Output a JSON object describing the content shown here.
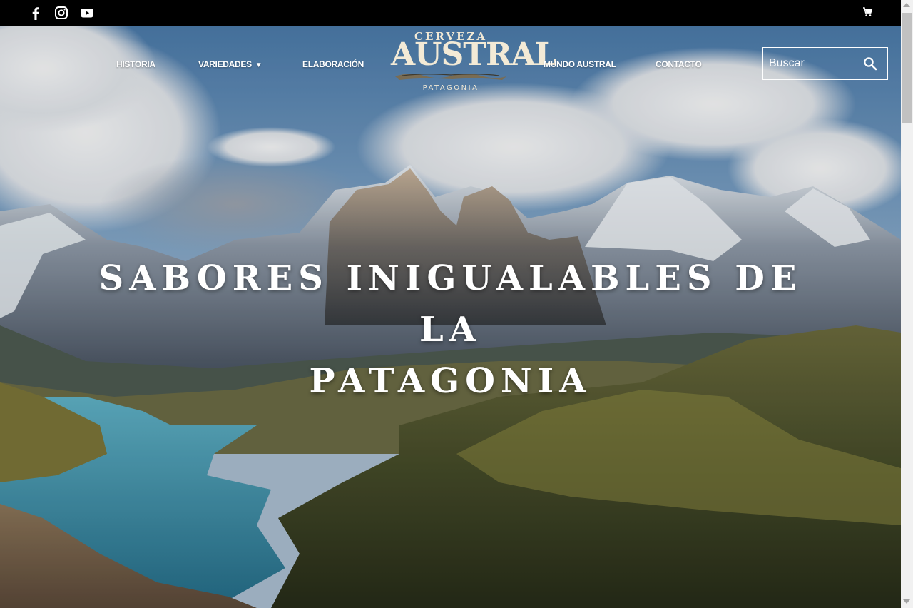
{
  "topbar": {
    "social": [
      {
        "icon": "facebook-icon"
      },
      {
        "icon": "instagram-icon"
      },
      {
        "icon": "youtube-icon"
      }
    ],
    "cart_icon": "cart-icon"
  },
  "nav": {
    "historia": "HISTORIA",
    "variedades": "VARIEDADES",
    "variedades_caret": "▼",
    "elaboracion": "ELABORACIÓN",
    "mundo_austral": "MUNDO AUSTRAL",
    "contacto": "CONTACTO"
  },
  "logo": {
    "top": "CERVEZA",
    "main": "AUSTRAL",
    "bottom": "PATAGONIA"
  },
  "search": {
    "placeholder": "Buscar",
    "icon": "search-icon"
  },
  "hero": {
    "headline_line1": "SABORES INIGUALABLES DE LA",
    "headline_line2": "PATAGONIA"
  },
  "colors": {
    "topbar": "#000000",
    "nav_text": "#ffffff",
    "logo_cream": "#f3ead6"
  }
}
